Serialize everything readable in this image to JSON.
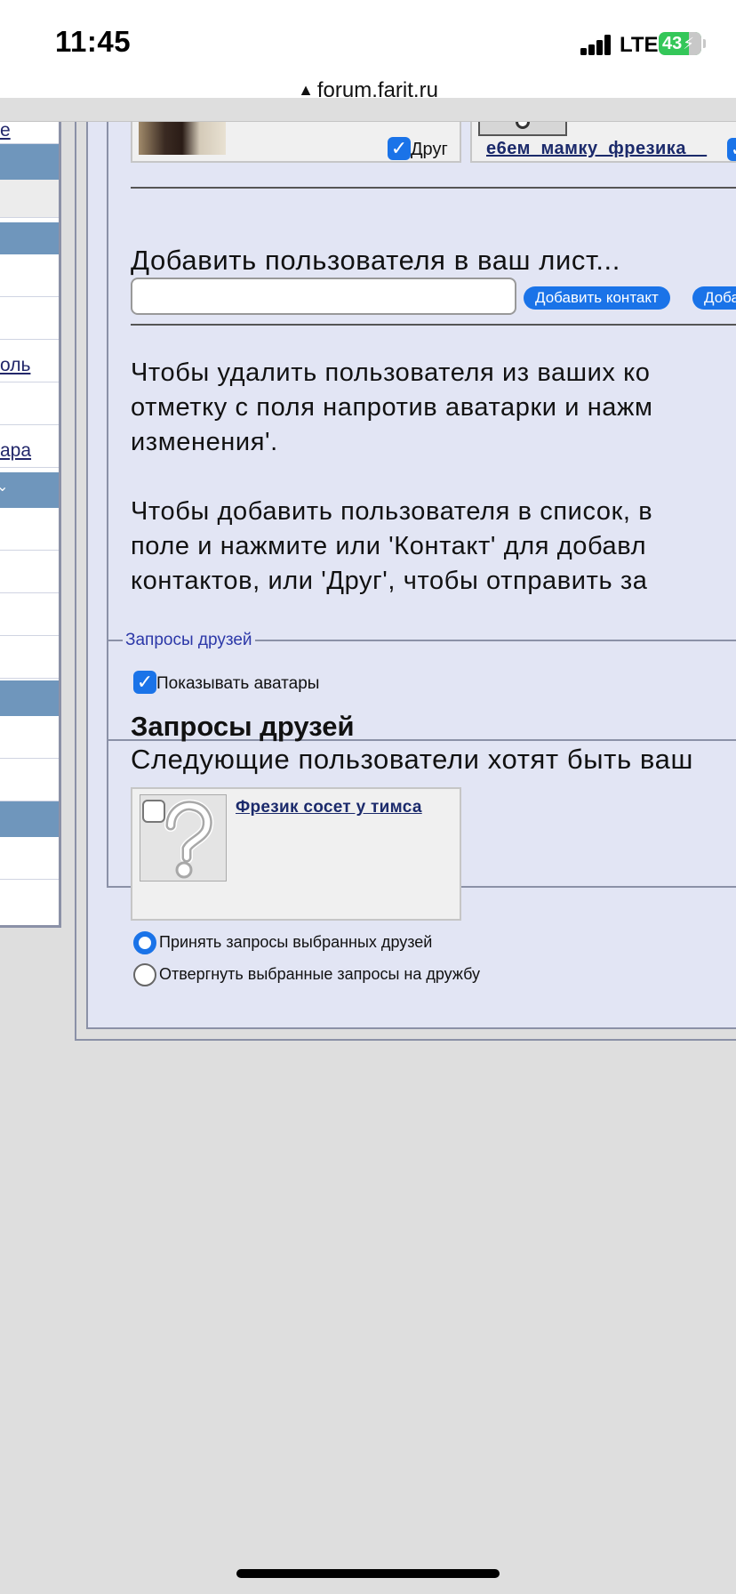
{
  "status_bar": {
    "time": "11:45",
    "network": "LTE",
    "battery": "43"
  },
  "browser": {
    "url": "forum.farit.ru"
  },
  "sidebar": {
    "links": [
      "e",
      "оль",
      "ара"
    ]
  },
  "contacts": {
    "friend_checkbox_label": "Друг",
    "friend_checkbox_checked": true,
    "second_user_link": "е6ем_мамку_фрезика__"
  },
  "add_user": {
    "label": "Добавить пользователя в ваш лист...",
    "input_value": "",
    "add_contact_button": "Добавить контакт",
    "add_friend_button": "Доба"
  },
  "help_text": {
    "remove_line1": "Чтобы удалить пользователя из ваших ко",
    "remove_line2": "отметку с поля напротив аватарки и нажм",
    "remove_line3": "изменения'.",
    "add_line1": "Чтобы добавить пользователя в список, в",
    "add_line2": "поле и нажмите или 'Контакт' для добавл",
    "add_line3": "контактов, или 'Друг', чтобы отправить за"
  },
  "friend_requests": {
    "legend": "Запросы друзей",
    "show_avatars_label": "Показывать аватары",
    "show_avatars_checked": true,
    "title": "Запросы друзей",
    "subtitle": "Следующие пользователи хотят быть ваш",
    "requester_name": "Фрезик сосет у тимса",
    "requester_checked": false,
    "accept_label": "Принять запросы выбранных друзей",
    "reject_label": "Отвергнуть выбранные запросы на дружбу",
    "selected_option": "accept"
  },
  "colors": {
    "accent": "#1a73e8",
    "sidebar_header": "#6f96bc",
    "panel_bg": "#e2e5f4",
    "page_bg": "#dedede",
    "battery": "#34c759"
  }
}
